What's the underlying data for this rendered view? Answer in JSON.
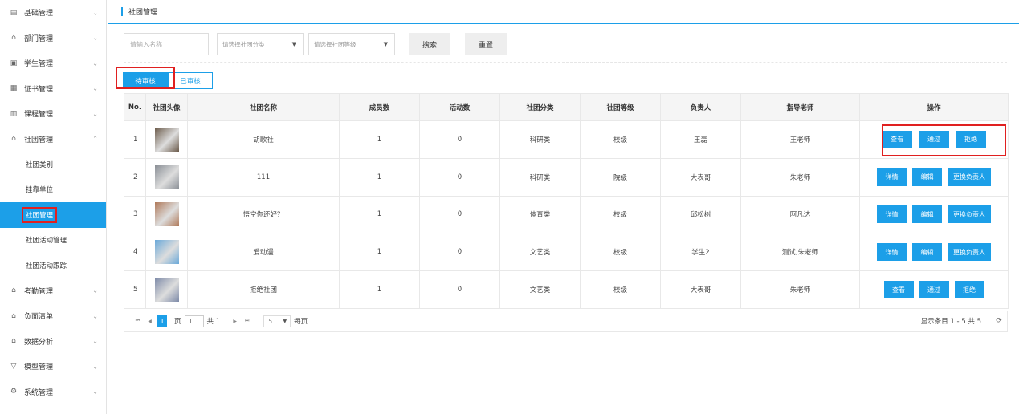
{
  "sidebar": {
    "items": [
      {
        "icon": "list-icon",
        "label": "基础管理"
      },
      {
        "icon": "building-icon",
        "label": "部门管理"
      },
      {
        "icon": "student-icon",
        "label": "学生管理"
      },
      {
        "icon": "certificate-icon",
        "label": "证书管理"
      },
      {
        "icon": "course-icon",
        "label": "课程管理"
      },
      {
        "icon": "building-icon",
        "label": "社团管理"
      }
    ],
    "sub_items": [
      "社团类别",
      "挂靠单位",
      "社团管理",
      "社团活动管理",
      "社团活动跟踪"
    ],
    "items_after": [
      {
        "icon": "building-icon",
        "label": "考勤管理"
      },
      {
        "icon": "building-icon",
        "label": "负面清单"
      },
      {
        "icon": "building-icon",
        "label": "数据分析"
      },
      {
        "icon": "filter-icon",
        "label": "模型管理"
      },
      {
        "icon": "gear-icon",
        "label": "系统管理"
      }
    ]
  },
  "header": {
    "title": "社团管理"
  },
  "filters": {
    "name_placeholder": "请输入名称",
    "category_placeholder": "请选择社团分类",
    "level_placeholder": "请选择社团等级",
    "search_label": "搜索",
    "reset_label": "重置"
  },
  "tabs": [
    {
      "label": "待审核"
    },
    {
      "label": "已审核"
    }
  ],
  "table": {
    "headers": [
      "No.",
      "社团头像",
      "社团名称",
      "成员数",
      "活动数",
      "社团分类",
      "社团等级",
      "负责人",
      "指导老师",
      "操作"
    ],
    "rows": [
      {
        "no": "1",
        "name": "胡歌社",
        "members": "1",
        "activities": "0",
        "category": "科研类",
        "level": "校级",
        "leader": "王磊",
        "teacher": "王老师",
        "ops": [
          "查看",
          "通过",
          "拒绝"
        ],
        "avatar_color": "#6b5a4a"
      },
      {
        "no": "2",
        "name": "111",
        "members": "1",
        "activities": "0",
        "category": "科研类",
        "level": "院级",
        "leader": "大表哥",
        "teacher": "朱老师",
        "ops": [
          "详情",
          "编辑",
          "更换负责人"
        ],
        "avatar_color": "#8a8f96"
      },
      {
        "no": "3",
        "name": "悟空你还好？",
        "members": "1",
        "activities": "0",
        "category": "体育类",
        "level": "校级",
        "leader": "邱松树",
        "teacher": "阿凡达",
        "ops": [
          "详情",
          "编辑",
          "更换负责人"
        ],
        "avatar_color": "#b07a5a"
      },
      {
        "no": "4",
        "name": "爱动漫",
        "members": "1",
        "activities": "0",
        "category": "文艺类",
        "level": "校级",
        "leader": "学生2",
        "teacher": "测试,朱老师",
        "ops": [
          "详情",
          "编辑",
          "更换负责人"
        ],
        "avatar_color": "#6aa9d9"
      },
      {
        "no": "5",
        "name": "拒绝社团",
        "members": "1",
        "activities": "0",
        "category": "文艺类",
        "level": "校级",
        "leader": "大表哥",
        "teacher": "朱老师",
        "ops": [
          "查看",
          "通过",
          "拒绝"
        ],
        "avatar_color": "#7d8aa8"
      }
    ]
  },
  "pager": {
    "current": "1",
    "page_label": "页",
    "page_input": "1",
    "total_label": "共 1",
    "page_size": "5",
    "per_page_label": "每页",
    "summary": "显示条目 1 - 5 共 5"
  }
}
